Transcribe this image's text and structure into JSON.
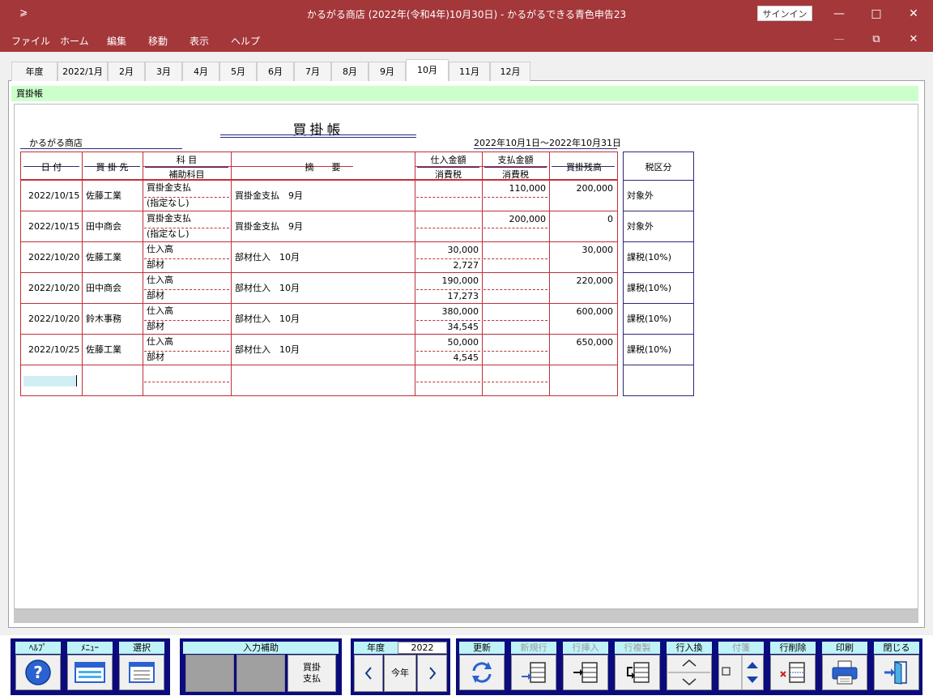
{
  "window": {
    "title": "かるがる商店 (2022年(令和4年)10月30日)  -  かるがるできる青色申告23",
    "signin_label": "サインイン",
    "qa_icon": "quick-access-icon"
  },
  "menu": [
    "ファイル",
    "ホーム",
    "編集",
    "移動",
    "表示",
    "ヘルプ"
  ],
  "tabs": [
    "年度",
    "2022/1月",
    "2月",
    "3月",
    "4月",
    "5月",
    "6月",
    "7月",
    "8月",
    "9月",
    "10月",
    "11月",
    "12月"
  ],
  "active_tab": "10月",
  "section_label": "買掛帳",
  "report": {
    "title": "買掛帳",
    "company": "かるがる商店",
    "period": "2022年10月1日～2022年10月31日"
  },
  "headers": {
    "date": "日 付",
    "vendor": "買 掛 先",
    "account": "科 目",
    "sub_account": "補助科目",
    "memo": "摘　　要",
    "purchase_amount": "仕入金額",
    "purchase_tax": "消費税",
    "payment_amount": "支払金額",
    "payment_tax": "消費税",
    "balance": "買掛残高",
    "tax_class": "税区分"
  },
  "rows": [
    {
      "date": "2022/10/15",
      "vendor": "佐藤工業",
      "account": "買掛金支払",
      "sub_account": "(指定なし)",
      "memo": "買掛金支払　9月",
      "purchase": "",
      "purchase_tax": "",
      "payment": "110,000",
      "payment_tax": "",
      "balance": "200,000",
      "tax_class": "対象外"
    },
    {
      "date": "2022/10/15",
      "vendor": "田中商会",
      "account": "買掛金支払",
      "sub_account": "(指定なし)",
      "memo": "買掛金支払　9月",
      "purchase": "",
      "purchase_tax": "",
      "payment": "200,000",
      "payment_tax": "",
      "balance": "0",
      "tax_class": "対象外"
    },
    {
      "date": "2022/10/20",
      "vendor": "佐藤工業",
      "account": "仕入高",
      "sub_account": "部材",
      "memo": "部材仕入　10月",
      "purchase": "30,000",
      "purchase_tax": "2,727",
      "payment": "",
      "payment_tax": "",
      "balance": "30,000",
      "tax_class": "課税(10%)"
    },
    {
      "date": "2022/10/20",
      "vendor": "田中商会",
      "account": "仕入高",
      "sub_account": "部材",
      "memo": "部材仕入　10月",
      "purchase": "190,000",
      "purchase_tax": "17,273",
      "payment": "",
      "payment_tax": "",
      "balance": "220,000",
      "tax_class": "課税(10%)"
    },
    {
      "date": "2022/10/20",
      "vendor": "鈴木事務",
      "account": "仕入高",
      "sub_account": "部材",
      "memo": "部材仕入　10月",
      "purchase": "380,000",
      "purchase_tax": "34,545",
      "payment": "",
      "payment_tax": "",
      "balance": "600,000",
      "tax_class": "課税(10%)"
    },
    {
      "date": "2022/10/25",
      "vendor": "佐藤工業",
      "account": "仕入高",
      "sub_account": "部材",
      "memo": "部材仕入　10月",
      "purchase": "50,000",
      "purchase_tax": "4,545",
      "payment": "",
      "payment_tax": "",
      "balance": "650,000",
      "tax_class": "課税(10%)"
    }
  ],
  "toolbar": {
    "help": "ﾍﾙﾌﾟ",
    "menu": "ﾒﾆｭｰ",
    "select": "選択",
    "input_assist": "入力補助",
    "assist_button": "買掛\n支払",
    "year_label": "年度",
    "year_value": "2022",
    "this_year": "今年",
    "update": "更新",
    "new_row": "新規行",
    "insert_row": "行挿入",
    "copy_row": "行複製",
    "swap_row": "行入換",
    "tag": "付箋",
    "delete_row": "行削除",
    "print": "印刷",
    "close": "閉じる"
  },
  "colors": {
    "titlebar": "#a4373a",
    "grid_red": "#c0303a",
    "toolbar_navy": "#0b0b7d",
    "label_cyan": "#bff3f7",
    "section_green": "#ccffcc"
  }
}
